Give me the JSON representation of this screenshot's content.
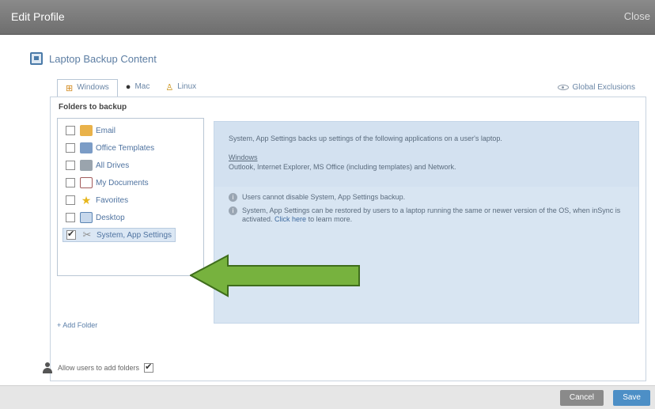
{
  "window": {
    "title": "Edit Profile",
    "close_label": "Close"
  },
  "section": {
    "title": "Laptop Backup Content"
  },
  "tabs": [
    {
      "label": "Windows",
      "icon": "windows-icon",
      "active": true
    },
    {
      "label": "Mac",
      "icon": "apple-icon",
      "active": false
    },
    {
      "label": "Linux",
      "icon": "linux-icon",
      "active": false
    }
  ],
  "global_exclusions": {
    "label": "Global Exclusions"
  },
  "folders": {
    "label": "Folders to backup",
    "items": [
      {
        "label": "Email",
        "checked": false,
        "icon": "email-folder-icon"
      },
      {
        "label": "Office Templates",
        "checked": false,
        "icon": "office-templates-icon"
      },
      {
        "label": "All Drives",
        "checked": false,
        "icon": "drives-icon"
      },
      {
        "label": "My Documents",
        "checked": false,
        "icon": "documents-icon"
      },
      {
        "label": "Favorites",
        "checked": false,
        "icon": "star-icon"
      },
      {
        "label": "Desktop",
        "checked": false,
        "icon": "desktop-icon"
      },
      {
        "label": "System, App Settings",
        "checked": true,
        "selected": true,
        "icon": "settings-tools-icon"
      }
    ],
    "add_label": "+ Add Folder"
  },
  "info": {
    "description": "System, App Settings backs up settings of the following applications on a user's laptop.",
    "windows_heading": "Windows",
    "windows_apps": "Outlook, Internet Explorer, MS Office (including templates) and Network.",
    "note1": "Users cannot disable System, App Settings backup.",
    "note2_text": "System, App Settings can be restored by users to a laptop running the same or newer version of the OS, when inSync is activated.",
    "note2_link": "Click here",
    "note2_suffix": "to learn more."
  },
  "allow": {
    "label": "Allow users to add folders",
    "checked": true
  },
  "buttons": {
    "cancel": "Cancel",
    "save": "Save"
  },
  "colors": {
    "arrow_fill": "#77b23e",
    "arrow_stroke": "#3f6d1c",
    "save": "#4d8fc6",
    "info_bg": "#d8e5f2"
  }
}
